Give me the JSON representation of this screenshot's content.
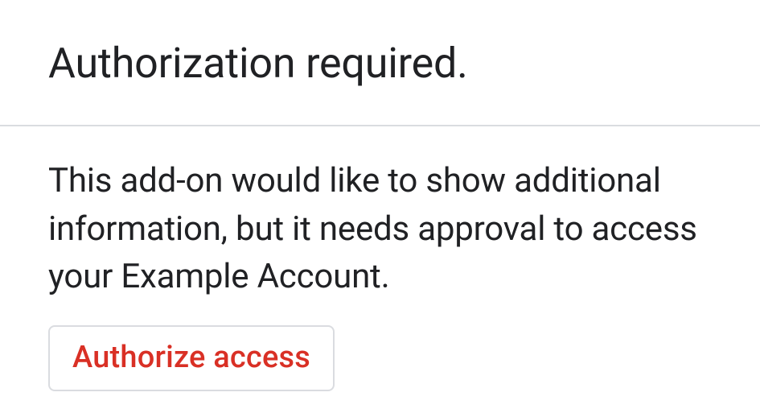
{
  "header": {
    "title": "Authorization required."
  },
  "body": {
    "message": "This add-on would like to show additional information, but it needs approval to access your Example Account."
  },
  "actions": {
    "authorize_label": "Authorize access"
  }
}
